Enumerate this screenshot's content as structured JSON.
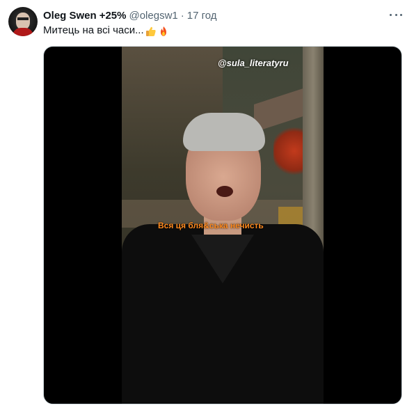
{
  "tweet": {
    "author_name": "Oleg Swen",
    "badge": "+25%",
    "handle": "@olegsw1",
    "separator": "·",
    "time": "17 год",
    "text": "Митець на всі часи...",
    "emojis": [
      "thumbs-up-emoji",
      "fire-emoji"
    ]
  },
  "media": {
    "watermark": "@sula_literatyru",
    "subtitle": "Вся ця бля&ська нечисть"
  },
  "colors": {
    "text_primary": "#0f1419",
    "text_secondary": "#536471",
    "subtitle": "#ff8a1e"
  }
}
